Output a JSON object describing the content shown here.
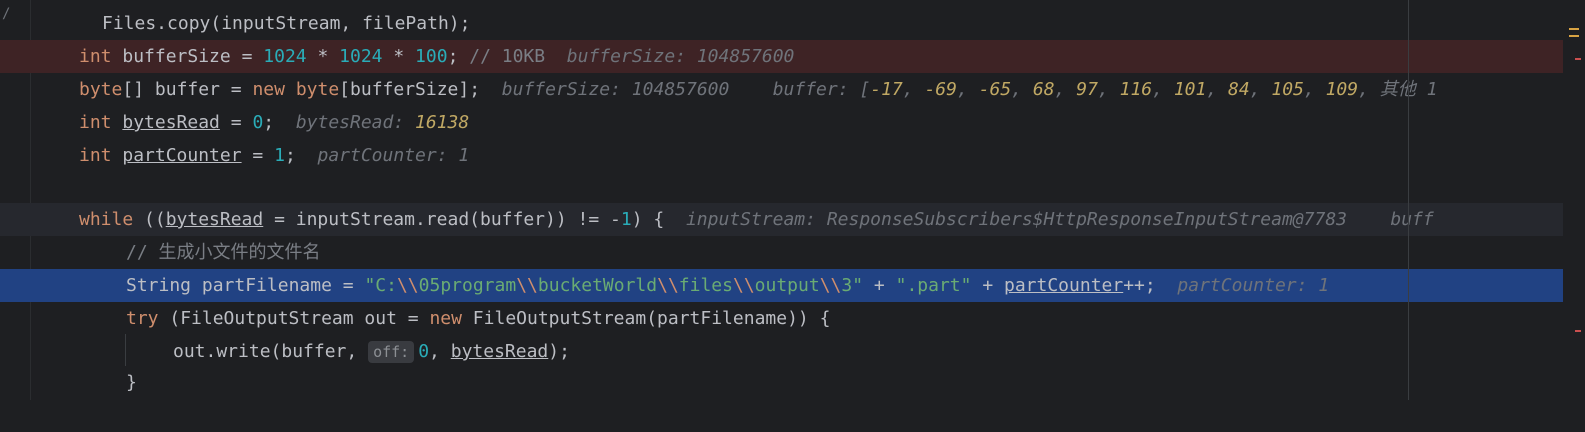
{
  "editor": {
    "gutter_marks": {
      "top": "/"
    },
    "lines": [
      {
        "id": "files-copy",
        "text": "Files.copy(inputStream, filePath);"
      },
      {
        "id": "buffer-size",
        "kw": "int",
        "name": "bufferSize",
        "op": "=",
        "n1": "1024",
        "mul1": "*",
        "n2": "1024",
        "mul2": "*",
        "n3": "100",
        "semi": ";",
        "comment": "// 10KB",
        "hint": "bufferSize: 104857600"
      },
      {
        "id": "buffer-decl",
        "kw_type": "byte",
        "brackets": "[]",
        "name": "buffer",
        "op": "=",
        "kw_new": "new",
        "type2": "byte",
        "arr_open": "[",
        "size": "bufferSize",
        "arr_close": "];",
        "hint1": "bufferSize: 104857600",
        "hint2_label": "buffer: [",
        "values": [
          "-17",
          "-69",
          "-65",
          "68",
          "97",
          "116",
          "101",
          "84",
          "105",
          "109"
        ],
        "hint2_more": "其他 1"
      },
      {
        "id": "bytes-read",
        "kw": "int",
        "name": "bytesRead",
        "op": "=",
        "value": "0",
        "semi": ";",
        "hint_label": "bytesRead:",
        "hint_value": "16138"
      },
      {
        "id": "part-counter",
        "kw": "int",
        "name": "partCounter",
        "op": "=",
        "value": "1",
        "semi": ";",
        "hint": "partCounter: 1"
      },
      {
        "id": "while-loop",
        "kw": "while",
        "p1": " ((",
        "var": "bytesRead",
        "mid": " = inputStream.read(buffer)",
        "p2": ")",
        "neq": " != -",
        "one": "1",
        "close": ") {",
        "hint": "inputStream: ResponseSubscribers$HttpResponseInputStream@7783",
        "hint2": "buff"
      },
      {
        "id": "comment",
        "text": "// 生成小文件的文件名"
      },
      {
        "id": "part-filename",
        "type": "String",
        "name": "partFilename",
        "op": "=",
        "str1_parts": [
          "\"C:",
          "\\\\",
          "05program",
          "\\\\",
          "bucketWorld",
          "\\\\",
          "files",
          "\\\\",
          "output",
          "\\\\",
          "3\""
        ],
        "plus1": "+",
        "str2": "\".part\"",
        "plus2": "+",
        "counter": "partCounter",
        "incr": "++;",
        "hint": "partCounter: 1"
      },
      {
        "id": "try-block",
        "kw_try": "try",
        "mid": " (FileOutputStream out = ",
        "kw_new": "new",
        "rest": " FileOutputStream(partFilename)) {"
      },
      {
        "id": "write",
        "pre": "out.write(buffer, ",
        "param_hint": "off:",
        "zero": "0",
        "comma": ", ",
        "var": "bytesRead",
        "end": ");"
      },
      {
        "id": "close-brace",
        "text": "}"
      }
    ]
  },
  "colors": {
    "background": "#1e1f22",
    "breakpoint_line": "#3e2325",
    "execution_line": "#214283",
    "keyword": "#cf8e6d",
    "number": "#2aacb8",
    "string": "#6aab73"
  }
}
